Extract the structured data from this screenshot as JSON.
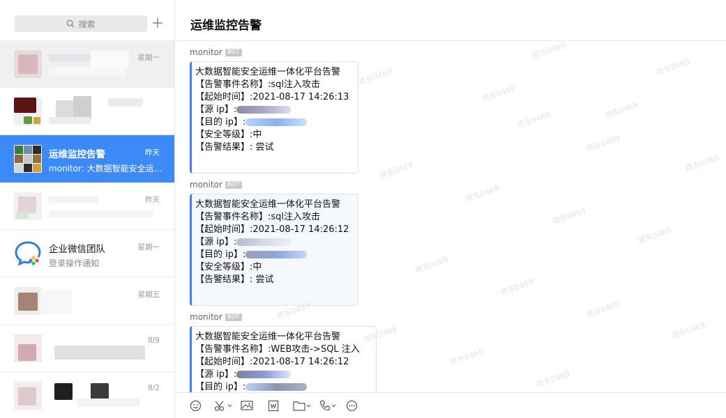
{
  "sidebar": {
    "search_placeholder": "搜索",
    "conversations": [
      {
        "name": "",
        "preview": "",
        "time": "星期一"
      },
      {
        "name": "",
        "preview": "",
        "time": ""
      },
      {
        "name": "运维监控告警",
        "preview": "monitor: 大数据智能安全运维一体化平台告警",
        "time": "昨天"
      },
      {
        "name": "",
        "preview": "",
        "time": "昨天"
      },
      {
        "name": "企业微信团队",
        "preview": "登录操作通知",
        "time": "星期一"
      },
      {
        "name": "",
        "preview": "",
        "time": "星期五"
      },
      {
        "name": "",
        "preview": "",
        "time": "8/9"
      },
      {
        "name": "",
        "preview": "",
        "time": "8/2"
      }
    ]
  },
  "chat": {
    "title": "运维监控告警",
    "messages": [
      {
        "sender": "monitor",
        "badge": "BOT",
        "lines": [
          "大数据智能安全运维一体化平台告警",
          "【告警事件名称】:sql注入攻击",
          "【起始时间】:2021-08-17 14:26:13",
          "【源 ip】:",
          "【目的 ip】:",
          "【安全等级】:中",
          "【告警结果】: 尝试"
        ]
      },
      {
        "sender": "monitor",
        "badge": "BOT",
        "lines": [
          "大数据智能安全运维一体化平台告警",
          "【告警事件名称】:sql注入攻击",
          "【起始时间】:2021-08-17 14:26:12",
          "【源 ip】:",
          "【目的 ip】:",
          "【安全等级】:中",
          "【告警结果】: 尝试"
        ]
      },
      {
        "sender": "monitor",
        "badge": "BOT",
        "lines": [
          "大数据智能安全运维一体化平台告警",
          "【告警事件名称】:WEB攻击->SQL 注入",
          "【起始时间】:2021-08-17 14:26:12",
          "【源 ip】:",
          "【目的 ip】:"
        ]
      }
    ]
  },
  "watermark": "项东0469",
  "colors": {
    "accent": "#3b8af8",
    "bubble_border": "#4a7ce0"
  }
}
